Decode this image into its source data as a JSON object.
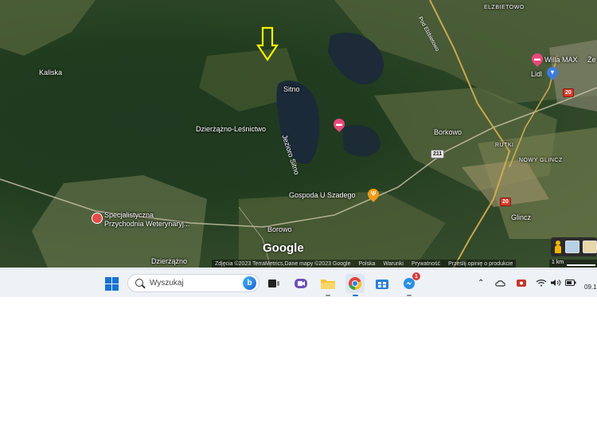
{
  "map": {
    "places": {
      "kaliska": "Kaliska",
      "sitno": "Sitno",
      "dzierzazno_lesnictwo": "Dzierżążno-Leśnictwo",
      "borkowo": "Borkowo",
      "borowo": "Borowo",
      "dzierzazno": "Dzierżążno",
      "glincz": "Glincz",
      "elzbietowo": "ELZBIETOWO",
      "rutki": "RUTKI",
      "nowy_glincz": "NOWY GLINCZ",
      "ze": "Że"
    },
    "lake_label": "Jezioro Sitno",
    "road_label": "Pod Elżbietowo",
    "road_shields": {
      "r211": "211",
      "r20a": "20",
      "r20b": "20"
    },
    "pois": {
      "willa_max": "Willa MAX",
      "lidl": "Lidl",
      "gospoda": "Gospoda U Szadego",
      "przychodnia_line1": "Specjalistyczna",
      "przychodnia_line2": "Przychodnia Weterynaryj..."
    },
    "logo": "Google",
    "attribution": {
      "imagery": "Zdjęcia ©2023 TerraMetrics,Dane mapy ©2023 Google",
      "country": "Polska",
      "terms": "Warunki",
      "privacy": "Prywatność",
      "feedback": "Prześlij opinię o produkcie",
      "scale": "1 km"
    },
    "marker_color": "#f2f200"
  },
  "taskbar": {
    "search_placeholder": "Wyszukaj",
    "bing_letter": "b",
    "notification_count": "1",
    "clock": "09.1",
    "accent": "#1673d6"
  }
}
